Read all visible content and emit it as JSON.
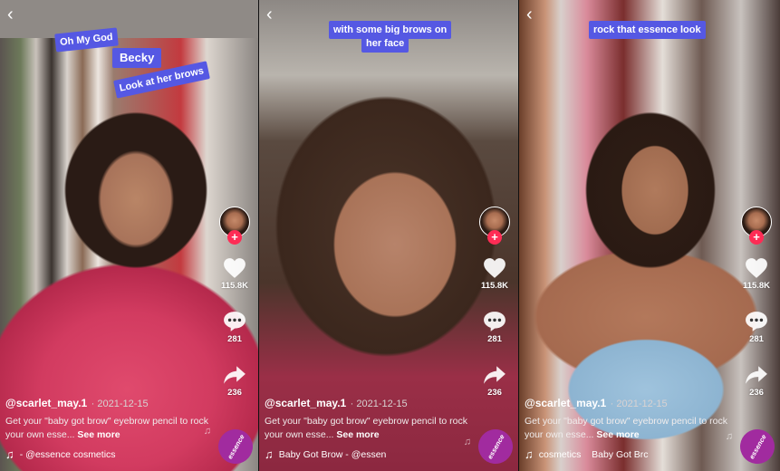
{
  "panels": [
    {
      "stickers": [
        "Oh My God",
        "Becky",
        "Look at her brows"
      ],
      "username": "@scarlet_may.1",
      "date": "· 2021-12-15",
      "description": "Get your \"baby got brow\" eyebrow pencil to rock your own esse...",
      "see_more": "See more",
      "music": "- @essence cosmetics",
      "likes": "115.8K",
      "comments": "281",
      "shares": "236",
      "disc_brand": "essence"
    },
    {
      "stickers": [
        "with some big brows on",
        "her face"
      ],
      "username": "@scarlet_may.1",
      "date": "· 2021-12-15",
      "description": "Get your \"baby got brow\" eyebrow pencil to rock your own esse...",
      "see_more": "See more",
      "music": "Baby Got Brow - @essen",
      "likes": "115.8K",
      "comments": "281",
      "shares": "236",
      "disc_brand": "essence"
    },
    {
      "stickers": [
        "rock that essence look"
      ],
      "username": "@scarlet_may.1",
      "date": "· 2021-12-15",
      "description": "Get your \"baby got brow\" eyebrow pencil to rock your own esse...",
      "see_more": "See more",
      "music": "cosmetics    Baby Got Brc",
      "likes": "115.8K",
      "comments": "281",
      "shares": "236",
      "disc_brand": "essence"
    }
  ],
  "icons": {
    "back": "‹",
    "plus": "+",
    "note": "♫"
  },
  "colors": {
    "sticker_bg": "#5558e3",
    "follow_plus": "#fe2c55",
    "disc_bg": "#a12b9f"
  }
}
